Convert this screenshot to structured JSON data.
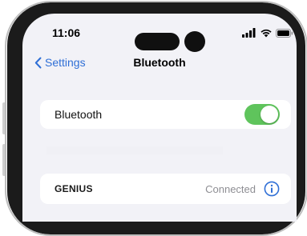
{
  "status_bar": {
    "time": "11:06",
    "icons": [
      "signal-icon",
      "wifi-icon",
      "battery-icon"
    ]
  },
  "nav": {
    "back_label": "Settings",
    "title": "Bluetooth"
  },
  "bluetooth_row": {
    "label": "Bluetooth",
    "toggle_on": true
  },
  "devices": [
    {
      "name": "GENIUS",
      "status": "Connected"
    }
  ],
  "colors": {
    "accent": "#2f6fd6",
    "toggle_on": "#5fc45c",
    "background": "#f2f2f7"
  }
}
